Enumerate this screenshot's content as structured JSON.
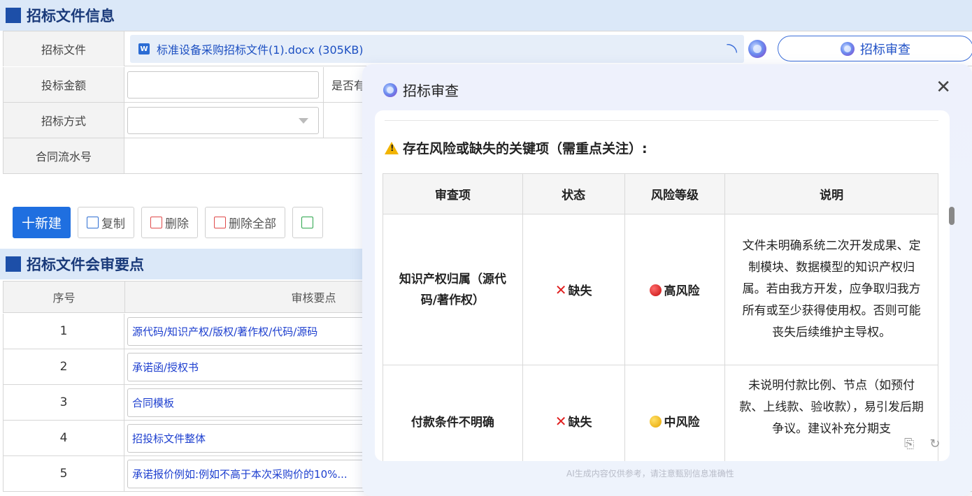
{
  "section1": {
    "title": "招标文件信息"
  },
  "form": {
    "file_label": "招标文件",
    "file_icon_text": "W",
    "file_name": "标准设备采购招标文件(1).docx (305KB)",
    "amount_label": "投标金额",
    "amount_partial_label": "是否有",
    "method_label": "招标方式",
    "serial_label": "合同流水号",
    "review_button": "招标审查"
  },
  "toolbar": {
    "new": "十新建",
    "copy": "复制",
    "delete": "删除",
    "delete_all": "删除全部"
  },
  "section2": {
    "title": "招标文件会审要点"
  },
  "grid": {
    "col_index": "序号",
    "col_point": "审核要点",
    "rows": [
      {
        "index": "1",
        "point": "源代码/知识产权/版权/著作权/代码/源码"
      },
      {
        "index": "2",
        "point": "承诺函/授权书"
      },
      {
        "index": "3",
        "point": "合同模板"
      },
      {
        "index": "4",
        "point": "招投标文件整体"
      },
      {
        "index": "5",
        "point": "承诺报价例如:例如不高于本次采购价的10%..."
      }
    ]
  },
  "panel": {
    "title": "招标审查",
    "close": "X",
    "warning": "存在风险或缺失的关键项（需重点关注）:",
    "headers": [
      "审查项",
      "状态",
      "风险等级",
      "说明"
    ],
    "rows": [
      {
        "item": "知识产权归属（源代码/著作权）",
        "status": "缺失",
        "risk": "高风险",
        "risk_color": "#d01010",
        "desc": "文件未明确系统二次开发成果、定制模块、数据模型的知识产权归属。若由我方开发，应争取归我方所有或至少获得使用权。否则可能丧失后续维护主导权。"
      },
      {
        "item": "付款条件不明确",
        "status": "缺失",
        "risk": "中风险",
        "risk_color": "#f0b000",
        "desc": "未说明付款比例、节点（如预付款、上线款、验收款），易引发后期争议。建议补充分期支"
      }
    ],
    "footnote": "AI生成内容仅供参考，请注意甄别信息准确性"
  }
}
